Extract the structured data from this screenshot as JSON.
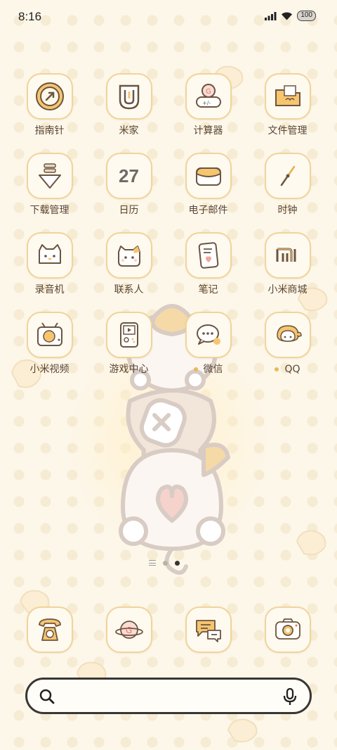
{
  "status_bar": {
    "time": "8:16",
    "battery": "100"
  },
  "apps": [
    {
      "label": "指南针",
      "icon": "compass-icon"
    },
    {
      "label": "米家",
      "icon": "mijia-icon"
    },
    {
      "label": "计算器",
      "icon": "calculator-icon"
    },
    {
      "label": "文件管理",
      "icon": "folder-icon"
    },
    {
      "label": "下载管理",
      "icon": "download-icon"
    },
    {
      "label": "日历",
      "icon": "calendar-icon",
      "date": "27"
    },
    {
      "label": "电子邮件",
      "icon": "mail-icon"
    },
    {
      "label": "时钟",
      "icon": "clock-icon"
    },
    {
      "label": "录音机",
      "icon": "recorder-icon"
    },
    {
      "label": "联系人",
      "icon": "contacts-icon"
    },
    {
      "label": "笔记",
      "icon": "notes-icon"
    },
    {
      "label": "小米商城",
      "icon": "mi-store-icon"
    },
    {
      "label": "小米视频",
      "icon": "video-icon"
    },
    {
      "label": "游戏中心",
      "icon": "game-center-icon"
    },
    {
      "label": "微信",
      "icon": "wechat-icon",
      "new_dot": true
    },
    {
      "label": "QQ",
      "icon": "qq-icon",
      "new_dot": true
    }
  ],
  "dock": [
    {
      "icon": "phone-icon"
    },
    {
      "icon": "browser-icon"
    },
    {
      "icon": "messages-icon"
    },
    {
      "icon": "camera-icon"
    }
  ],
  "page_indicator": {
    "pages": 2,
    "active_page": 2
  }
}
